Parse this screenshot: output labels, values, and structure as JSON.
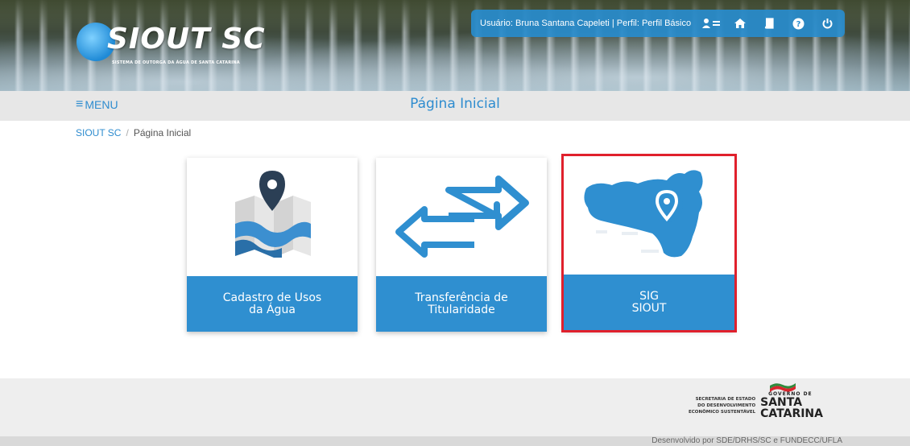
{
  "header": {
    "logo_text": "SIOUT SC",
    "logo_subtitle": "SISTEMA DE OUTORGA DA ÁGUA DE SANTA CATARINA",
    "user_info": "Usuário: Bruna Santana Capeleti | Perfil: Perfil Básico",
    "icons": [
      "users-settings-icon",
      "home-icon",
      "book-icon",
      "help-icon",
      "power-icon"
    ],
    "accent_color": "#2e8ccf"
  },
  "titlebar": {
    "menu_label": "MENU",
    "page_title": "Página Inicial"
  },
  "breadcrumb": {
    "root": "SIOUT SC",
    "separator": "/",
    "current": "Página Inicial"
  },
  "cards": [
    {
      "label": "Cadastro de Usos\nda Água",
      "icon": "map-pin-icon",
      "selected": false
    },
    {
      "label": "Transferência de\nTitularidade",
      "icon": "transfer-arrows-icon",
      "selected": false
    },
    {
      "label": "SIG\nSIOUT",
      "icon": "santa-catarina-map-icon",
      "selected": true
    }
  ],
  "footer": {
    "secretaria_line1": "SECRETARIA DE ESTADO",
    "secretaria_line2": "DO DESENVOLVIMENTO",
    "secretaria_line3": "ECONÔMICO SUSTENTÁVEL",
    "governo_small": "GOVERNO DE",
    "governo_line1": "SANTA",
    "governo_line2": "CATARINA",
    "credits": "Desenvolvido por SDE/DRHS/SC e FUNDECC/UFLA"
  },
  "colors": {
    "card_label_bg": "#2f8fd0",
    "selection_outline": "#e0202c",
    "titlebar_bg": "#e7e7e7"
  }
}
